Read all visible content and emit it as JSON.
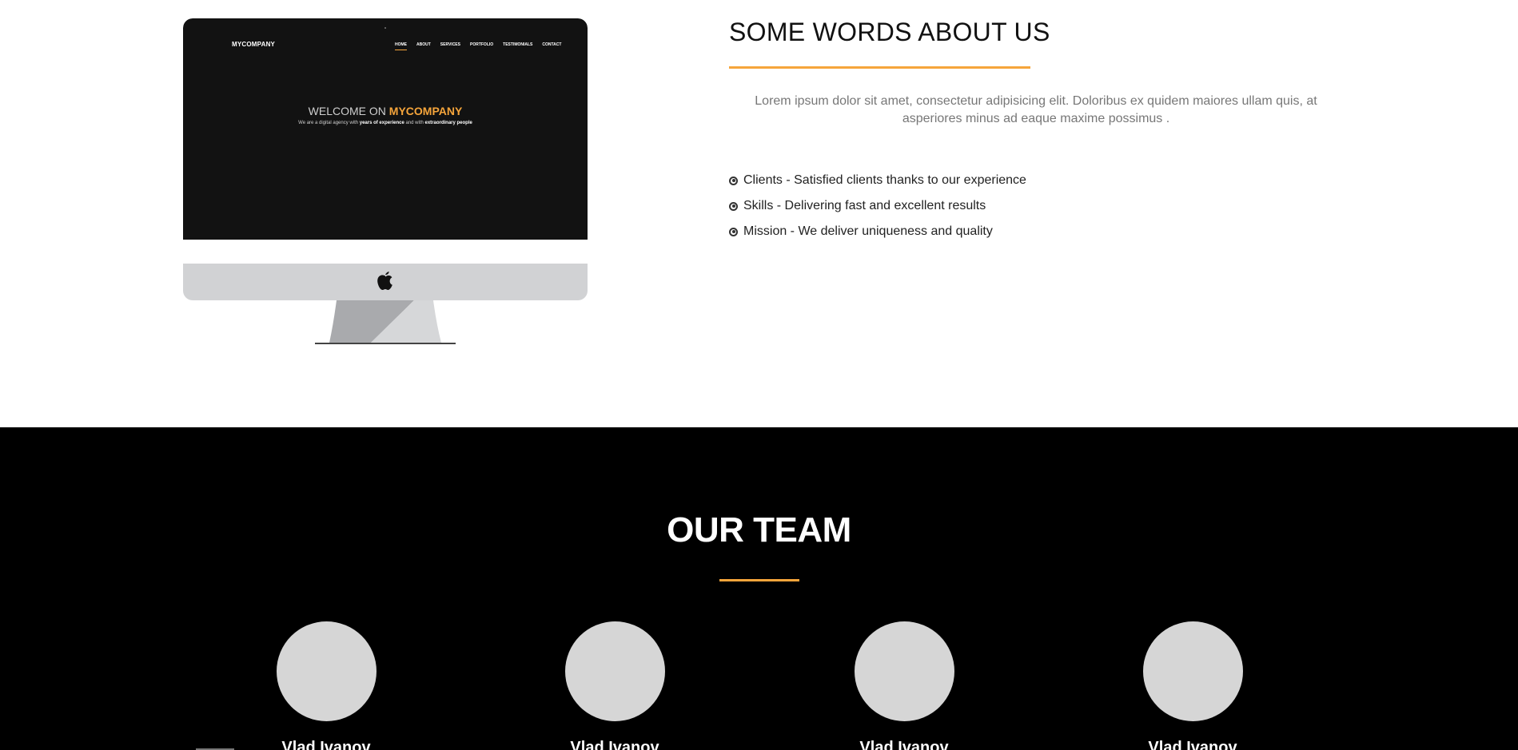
{
  "mockup": {
    "brand": "MYCOMPANY",
    "nav": [
      "HOME",
      "ABOUT",
      "SERVICES",
      "PORTFOLIO",
      "TESTIMONIALS",
      "CONTACT"
    ],
    "welcome_prefix": "WELCOME ON ",
    "welcome_brand": "MYCOMPANY",
    "tagline_1": "We are a digital agency with ",
    "tagline_2": "years of experience",
    "tagline_3": " and with ",
    "tagline_4": "extraordinary people"
  },
  "about": {
    "title": "SOME WORDS ABOUT US",
    "text": "Lorem ipsum dolor sit amet, consectetur adipisicing elit. Doloribus ex quidem maiores ullam quis, at asperiores minus ad eaque maxime possimus .",
    "features": [
      "Clients - Satisfied clients thanks to our experience",
      "Skills - Delivering fast and excellent results",
      "Mission - We deliver uniqueness and quality"
    ]
  },
  "team": {
    "title": "OUR TEAM",
    "members": [
      {
        "name": "Vlad Ivanov"
      },
      {
        "name": "Vlad Ivanov"
      },
      {
        "name": "Vlad Ivanov"
      },
      {
        "name": "Vlad Ivanov"
      }
    ]
  },
  "colors": {
    "accent": "#f6a53b",
    "team_bg": "#000000",
    "avatar": "#d6d6d6"
  },
  "icons": {
    "feature_bullet": "dot-circle-icon",
    "monitor_logo": "apple-logo-icon"
  }
}
